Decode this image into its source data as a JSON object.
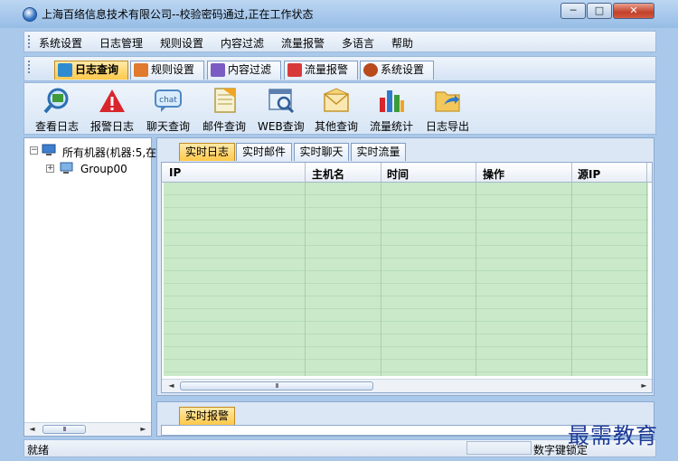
{
  "window": {
    "title": "上海百络信息技术有限公司--校验密码通过,正在工作状态",
    "controls": {
      "minimize": "─",
      "maximize": "□",
      "close": "✕"
    }
  },
  "menu": {
    "items": [
      {
        "label": "系统设置"
      },
      {
        "label": "日志管理"
      },
      {
        "label": "规则设置"
      },
      {
        "label": "内容过滤"
      },
      {
        "label": "流量报警"
      },
      {
        "label": "多语言"
      },
      {
        "label": "帮助"
      }
    ]
  },
  "top_tabs": [
    {
      "label": "日志查询",
      "icon": "log-search-icon",
      "color": "#2f8bd1",
      "active": true
    },
    {
      "label": "规则设置",
      "icon": "rules-icon",
      "color": "#e07a2e",
      "active": false
    },
    {
      "label": "内容过滤",
      "icon": "filter-icon",
      "color": "#7a5cc2",
      "active": false
    },
    {
      "label": "流量报警",
      "icon": "traffic-alarm-icon",
      "color": "#d83a3a",
      "active": false
    },
    {
      "label": "系统设置",
      "icon": "system-settings-icon",
      "color": "#b84a1b",
      "active": false
    }
  ],
  "toolbar": {
    "items": [
      {
        "label": "查看日志",
        "icon": "view-log-icon"
      },
      {
        "label": "报警日志",
        "icon": "alarm-log-icon"
      },
      {
        "label": "聊天查询",
        "icon": "chat-query-icon"
      },
      {
        "label": "邮件查询",
        "icon": "mail-query-icon"
      },
      {
        "label": "WEB查询",
        "icon": "web-query-icon"
      },
      {
        "label": "其他查询",
        "icon": "other-query-icon"
      },
      {
        "label": "流量统计",
        "icon": "traffic-stats-icon"
      },
      {
        "label": "日志导出",
        "icon": "log-export-icon"
      }
    ]
  },
  "tree": {
    "root_label": "所有机器(机器:5,在",
    "child_label": "Group00",
    "expander_minus": "−",
    "expander_plus": "+"
  },
  "scroll": {
    "left": "◄",
    "right": "►",
    "thumb": "III"
  },
  "realtime_tabs": [
    {
      "label": "实时日志",
      "active": true
    },
    {
      "label": "实时邮件",
      "active": false
    },
    {
      "label": "实时聊天",
      "active": false
    },
    {
      "label": "实时流量",
      "active": false
    }
  ],
  "grid": {
    "columns": [
      "IP",
      "主机名",
      "时间",
      "操作",
      "源IP"
    ]
  },
  "bottom_tab": {
    "label": "实时报警"
  },
  "status": {
    "left": "就绪",
    "right": "数字键锁定"
  },
  "watermark": "最需教育",
  "colors": {
    "active_tab": "#ffc94a",
    "grid_row": "#c9e9c9",
    "accent": "#2f6fc0"
  }
}
